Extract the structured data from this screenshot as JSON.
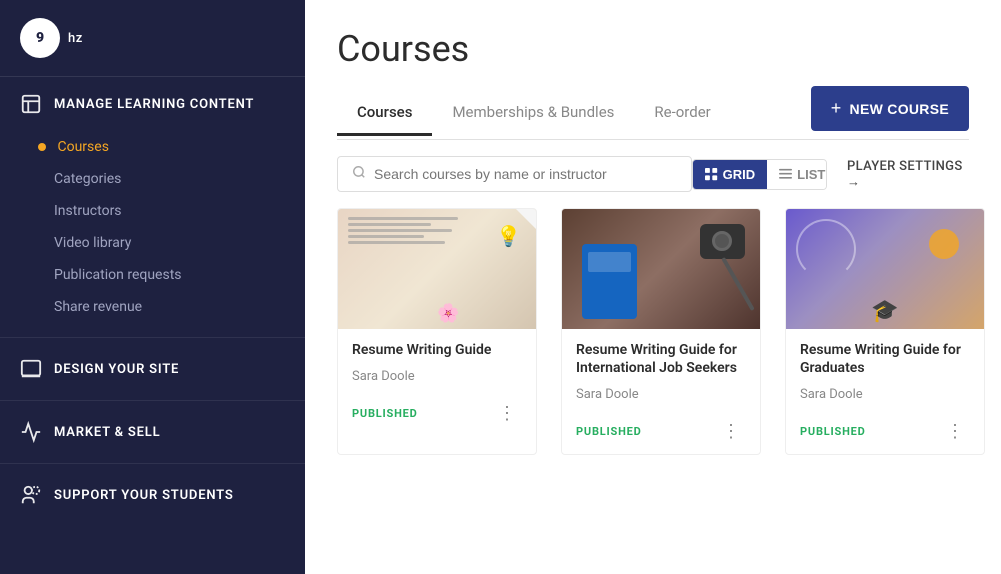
{
  "sidebar": {
    "logo": {
      "icon": "9",
      "text": "hz"
    },
    "sections": [
      {
        "id": "manage-learning",
        "icon": "📋",
        "label": "MANAGE LEARNING CONTENT",
        "subItems": [
          {
            "id": "courses",
            "label": "Courses",
            "active": true
          },
          {
            "id": "categories",
            "label": "Categories",
            "active": false
          },
          {
            "id": "instructors",
            "label": "Instructors",
            "active": false
          },
          {
            "id": "video-library",
            "label": "Video library",
            "active": false
          },
          {
            "id": "publication-requests",
            "label": "Publication requests",
            "active": false
          },
          {
            "id": "share-revenue",
            "label": "Share revenue",
            "active": false
          }
        ]
      },
      {
        "id": "design-site",
        "icon": "🎨",
        "label": "DESIGN YOUR SITE",
        "subItems": []
      },
      {
        "id": "market-sell",
        "icon": "📊",
        "label": "MARKET & SELL",
        "subItems": []
      },
      {
        "id": "support-students",
        "icon": "👥",
        "label": "SUPPORT YOUR STUDENTS",
        "subItems": []
      }
    ]
  },
  "main": {
    "page_title": "Courses",
    "tabs": [
      {
        "id": "courses",
        "label": "Courses",
        "active": true
      },
      {
        "id": "memberships",
        "label": "Memberships & Bundles",
        "active": false
      },
      {
        "id": "reorder",
        "label": "Re-order",
        "active": false
      }
    ],
    "new_course_button": "+ NEW COURSE",
    "new_course_plus": "+",
    "new_course_label": "NEW COURSE",
    "search": {
      "placeholder": "Search courses by name or instructor"
    },
    "view_buttons": [
      {
        "id": "grid",
        "label": "GRID",
        "active": true
      },
      {
        "id": "list",
        "label": "LIST",
        "active": false
      }
    ],
    "player_settings": "PLAYER SETTINGS →",
    "courses": [
      {
        "id": "course-1",
        "title": "Resume Writing Guide",
        "author": "Sara Doole",
        "status": "PUBLISHED",
        "thumb_type": "desk"
      },
      {
        "id": "course-2",
        "title": "Resume Writing Guide for International Job Seekers",
        "author": "Sara Doole",
        "status": "PUBLISHED",
        "thumb_type": "passport"
      },
      {
        "id": "course-3",
        "title": "Resume Writing Guide for Graduates",
        "author": "Sara Doole",
        "status": "PUBLISHED",
        "thumb_type": "sunset"
      }
    ]
  }
}
